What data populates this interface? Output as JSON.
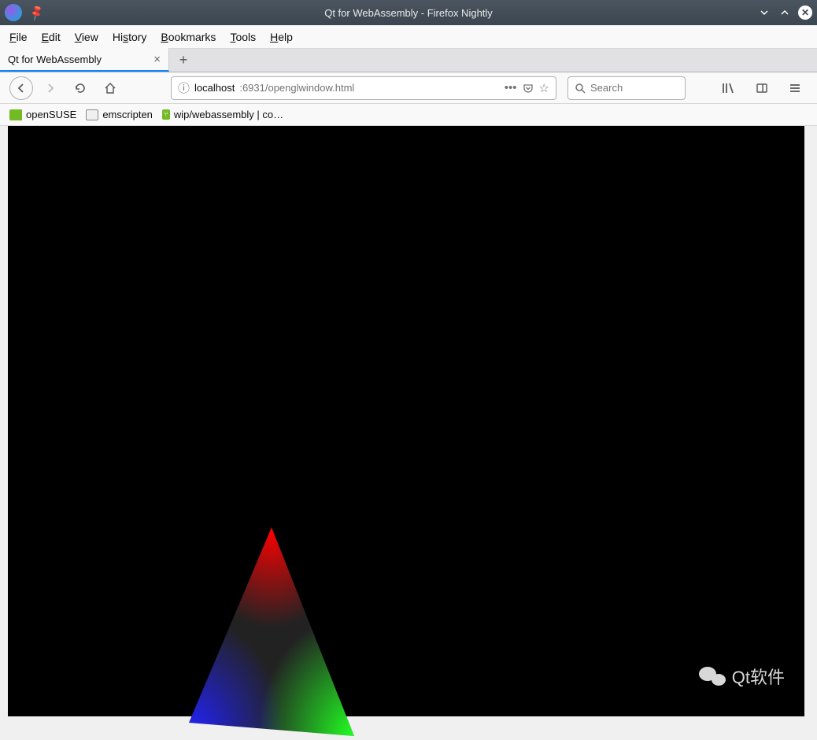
{
  "window": {
    "title": "Qt for WebAssembly - Firefox Nightly"
  },
  "menu": {
    "file": "File",
    "edit": "Edit",
    "view": "View",
    "history": "History",
    "bookmarks": "Bookmarks",
    "tools": "Tools",
    "help": "Help"
  },
  "tab": {
    "title": "Qt for WebAssembly"
  },
  "url": {
    "host": "localhost",
    "path": ":6931/openglwindow.html"
  },
  "search": {
    "placeholder": "Search"
  },
  "bookmarks": [
    {
      "label": "openSUSE",
      "icon": "flag"
    },
    {
      "label": "emscripten",
      "icon": "folder"
    },
    {
      "label": "wip/webassembly | co…",
      "icon": "branch"
    }
  ],
  "watermark": {
    "text": "Qt软件"
  }
}
